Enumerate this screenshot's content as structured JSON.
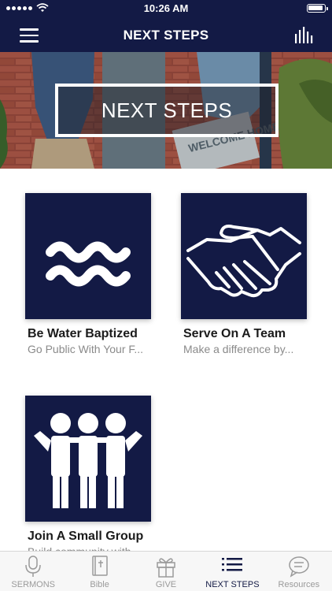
{
  "status_bar": {
    "time": "10:26 AM"
  },
  "nav": {
    "title": "NEXT STEPS"
  },
  "hero": {
    "text": "NEXT STEPS",
    "sign_text": "WELCOME HOME"
  },
  "cards": [
    {
      "title": "Be Water Baptized",
      "subtitle": "Go Public With Your F...",
      "icon": "waves-icon"
    },
    {
      "title": "Serve On A Team",
      "subtitle": "Make a difference by...",
      "icon": "handshake-icon"
    },
    {
      "title": "Join A Small Group",
      "subtitle": "Build community with",
      "icon": "group-icon"
    }
  ],
  "tabs": [
    {
      "label": "SERMONS",
      "icon": "microphone-icon"
    },
    {
      "label": "Bible",
      "icon": "bible-icon"
    },
    {
      "label": "GIVE",
      "icon": "gift-icon"
    },
    {
      "label": "NEXT STEPS",
      "icon": "list-icon",
      "active": true
    },
    {
      "label": "Resources",
      "icon": "chat-icon"
    }
  ],
  "colors": {
    "primary": "#131a45",
    "tab_inactive": "#9a9a9a"
  }
}
